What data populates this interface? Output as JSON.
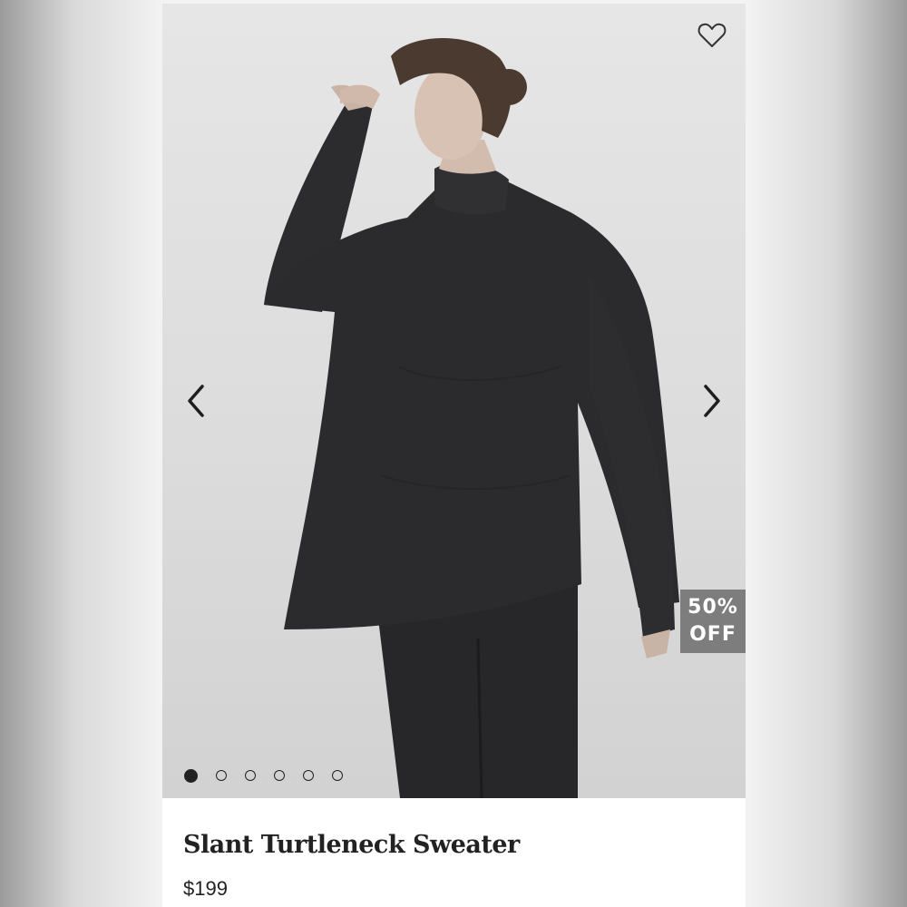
{
  "product": {
    "name": "Slant Turtleneck Sweater",
    "price": "$199"
  },
  "badge": {
    "line1": "50%",
    "line2": "OFF"
  },
  "carousel": {
    "slide_count": 6,
    "active_index": 0
  },
  "icons": {
    "favorite": "heart-outline-icon",
    "previous": "chevron-left-icon",
    "next": "chevron-right-icon"
  },
  "colors": {
    "badge_background": "#7d7d7d",
    "text": "#222222",
    "garment": "#2b2b2d"
  }
}
